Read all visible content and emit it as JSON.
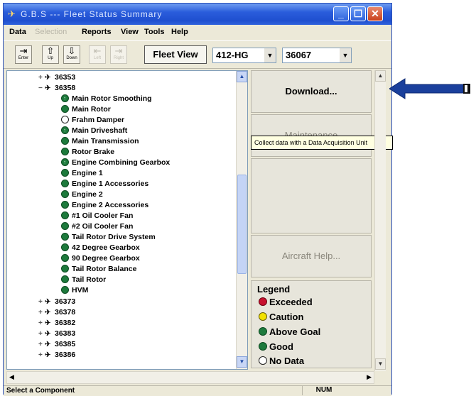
{
  "window": {
    "title": "G.B.S --- Fleet Status Summary"
  },
  "menu": {
    "items": [
      "Data",
      "Selection",
      "Reports",
      "View",
      "Tools",
      "Help"
    ]
  },
  "toolbar": {
    "tool_labels": [
      "Enter",
      "Up",
      "Down",
      "Left",
      "Right"
    ],
    "fleet_view_label": "Fleet View",
    "aircraft_type": "412-HG",
    "aircraft_serial": "36067"
  },
  "tree": {
    "nodes": [
      {
        "label": "36353",
        "level": 0,
        "expander": "+"
      },
      {
        "label": "36358",
        "level": 0,
        "expander": "−"
      },
      {
        "label": "Main Rotor Smoothing",
        "level": 1,
        "status": "above"
      },
      {
        "label": "Main Rotor",
        "level": 1,
        "status": "good"
      },
      {
        "label": "Frahm Damper",
        "level": 1,
        "status": "none"
      },
      {
        "label": "Main Driveshaft",
        "level": 1,
        "status": "above"
      },
      {
        "label": "Main Transmission",
        "level": 1,
        "status": "good"
      },
      {
        "label": "Rotor Brake",
        "level": 1,
        "status": "good"
      },
      {
        "label": "Engine Combining Gearbox",
        "level": 1,
        "status": "above"
      },
      {
        "label": "Engine 1",
        "level": 1,
        "status": "good"
      },
      {
        "label": "Engine 1 Accessories",
        "level": 1,
        "status": "good"
      },
      {
        "label": "Engine 2",
        "level": 1,
        "status": "good"
      },
      {
        "label": "Engine 2 Accessories",
        "level": 1,
        "status": "good"
      },
      {
        "label": "#1 Oil Cooler Fan",
        "level": 1,
        "status": "good"
      },
      {
        "label": "#2 Oil Cooler Fan",
        "level": 1,
        "status": "good"
      },
      {
        "label": "Tail Rotor Drive System",
        "level": 1,
        "status": "good"
      },
      {
        "label": "42 Degree Gearbox",
        "level": 1,
        "status": "good"
      },
      {
        "label": "90 Degree Gearbox",
        "level": 1,
        "status": "good"
      },
      {
        "label": "Tail Rotor Balance",
        "level": 1,
        "status": "good"
      },
      {
        "label": "Tail Rotor",
        "level": 1,
        "status": "good"
      },
      {
        "label": "HVM",
        "level": 1,
        "status": "good"
      },
      {
        "label": "36373",
        "level": 0,
        "expander": "+"
      },
      {
        "label": "36378",
        "level": 0,
        "expander": "+"
      },
      {
        "label": "36382",
        "level": 0,
        "expander": "+"
      },
      {
        "label": "36383",
        "level": 0,
        "expander": "+"
      },
      {
        "label": "36385",
        "level": 0,
        "expander": "+"
      },
      {
        "label": "36386",
        "level": 0,
        "expander": "+"
      }
    ]
  },
  "actions": {
    "download_label": "Download...",
    "second_label": "Maintenance",
    "tooltip": "Collect data with a Data Acquisition Unit",
    "aircraft_help_label": "Aircraft Help..."
  },
  "legend": {
    "title": "Legend",
    "items": [
      {
        "label": "Exceeded",
        "color": "#c8102e",
        "icon": "exceeded-icon"
      },
      {
        "label": "Caution",
        "color": "#f2e100",
        "icon": "caution-icon"
      },
      {
        "label": "Above Goal",
        "color": "#1d7a3c",
        "icon": "above-goal-icon"
      },
      {
        "label": "Good",
        "color": "#1d7a3c",
        "icon": "good-icon"
      },
      {
        "label": "No Data",
        "color": "#ffffff",
        "icon": "no-data-icon"
      }
    ]
  },
  "status": {
    "text": "Select a Component",
    "num": "NUM"
  },
  "colors": {
    "title_bar": "#2a5ddc",
    "arrow": "#1a3f9c"
  }
}
